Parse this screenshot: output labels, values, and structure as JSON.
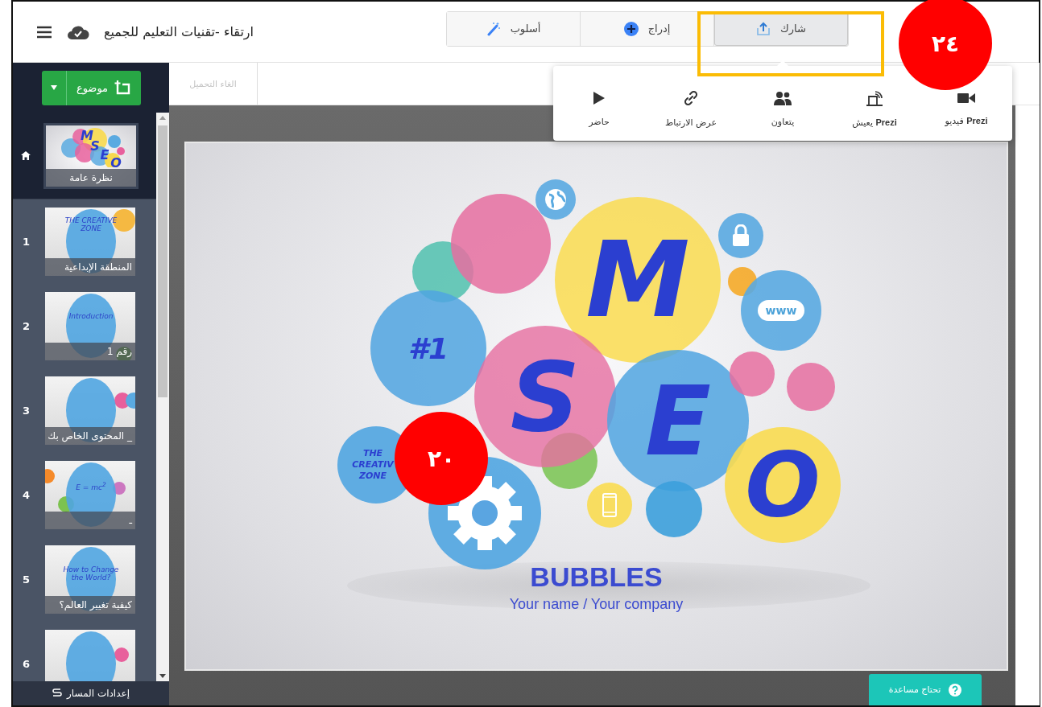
{
  "header": {
    "title": "ارتقاء -تقنيات التعليم للجميع",
    "tabs": [
      {
        "label": "شارك",
        "kind": "share",
        "selected": true
      },
      {
        "label": "إدراج",
        "kind": "insert",
        "selected": false
      },
      {
        "label": "أسلوب",
        "kind": "style",
        "selected": false
      }
    ]
  },
  "share_menu": {
    "items": [
      {
        "label": "**Prezi** فيديو",
        "kind": "video"
      },
      {
        "label": "**Prezi** يعيش",
        "kind": "cast"
      },
      {
        "label": "يتعاون",
        "kind": "people"
      },
      {
        "label": "عرض الارتباط",
        "kind": "link"
      },
      {
        "label": "حاضر",
        "kind": "play"
      }
    ]
  },
  "sidebar": {
    "add_button": "موضوع",
    "overview": {
      "caption": "نظرة عامة",
      "thumb_letters": [
        "M",
        "S",
        "E",
        "O"
      ],
      "selected": true
    },
    "slides": [
      {
        "number": "1",
        "caption": "المنطقة الإبداعية",
        "thumb_text": "THE CREATIVE ZONE",
        "selected": false
      },
      {
        "number": "2",
        "caption": "رقم 1",
        "thumb_text": "Introduction",
        "selected": false
      },
      {
        "number": "3",
        "caption": "_ المحتوى الخاص بك",
        "selected": false
      },
      {
        "number": "4",
        "caption": "ـ",
        "thumb_text": "E = mc$^{2}$",
        "selected": false
      },
      {
        "number": "5",
        "caption": "كيفية تغيير العالم؟",
        "thumb_text": "How to Change the World?",
        "selected": false
      },
      {
        "number": "6",
        "selected": false
      }
    ],
    "footer": "إعدادات المسار"
  },
  "toolbar": {
    "undo": {
      "label": "الغاء التحميل",
      "disabled": true
    }
  },
  "slide": {
    "letters": [
      "M",
      "S",
      "E",
      "O"
    ],
    "badge": "#1",
    "zone": "THE CREATIV ZONE",
    "cloud": "www",
    "title": "BUBBLES",
    "subtitle": "Your name / Your company"
  },
  "help_button": "تحتاج مساعدة",
  "annotations": [
    {
      "kind": "highlight"
    },
    {
      "kind": "marker",
      "label": "٢٤"
    },
    {
      "kind": "marker",
      "label": "٢٠"
    }
  ]
}
